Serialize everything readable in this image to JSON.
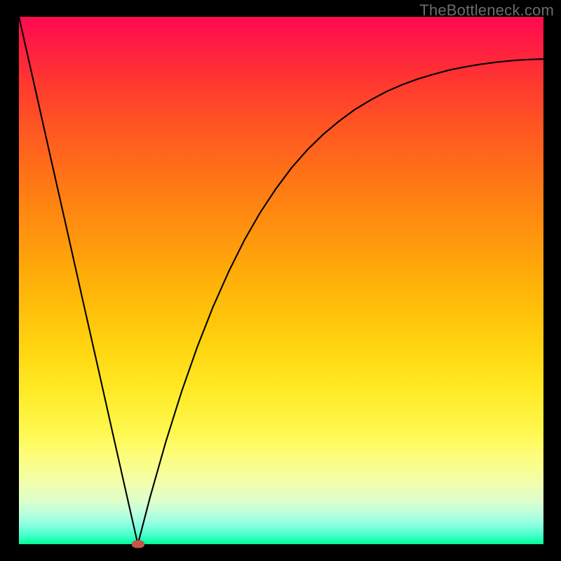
{
  "watermark": {
    "text": "TheBottleneck.com"
  },
  "chart_data": {
    "type": "line",
    "title": "",
    "xlabel": "",
    "ylabel": "",
    "xlim": [
      0,
      1
    ],
    "ylim": [
      0,
      1
    ],
    "grid": false,
    "legend": false,
    "series": [
      {
        "name": "left-branch",
        "x": [
          0.0,
          0.03,
          0.06,
          0.09,
          0.12,
          0.15,
          0.18,
          0.21,
          0.2267
        ],
        "y": [
          1.0,
          0.868,
          0.735,
          0.603,
          0.47,
          0.338,
          0.205,
          0.073,
          0.0
        ]
      },
      {
        "name": "right-branch",
        "x": [
          0.2267,
          0.25,
          0.28,
          0.31,
          0.34,
          0.37,
          0.4,
          0.43,
          0.46,
          0.49,
          0.52,
          0.55,
          0.58,
          0.61,
          0.64,
          0.67,
          0.7,
          0.73,
          0.76,
          0.79,
          0.82,
          0.85,
          0.88,
          0.91,
          0.94,
          0.97,
          1.0
        ],
        "y": [
          0.0,
          0.089,
          0.194,
          0.289,
          0.374,
          0.45,
          0.517,
          0.577,
          0.629,
          0.674,
          0.714,
          0.748,
          0.777,
          0.802,
          0.824,
          0.842,
          0.858,
          0.871,
          0.882,
          0.891,
          0.899,
          0.905,
          0.91,
          0.914,
          0.917,
          0.919,
          0.92
        ]
      }
    ],
    "min_marker": {
      "x": 0.2267,
      "y": 0.0,
      "color": "#c0574d"
    },
    "background": {
      "type": "vertical-gradient",
      "top_color": "#ff0b50",
      "bottom_color": "#00ff94"
    }
  }
}
